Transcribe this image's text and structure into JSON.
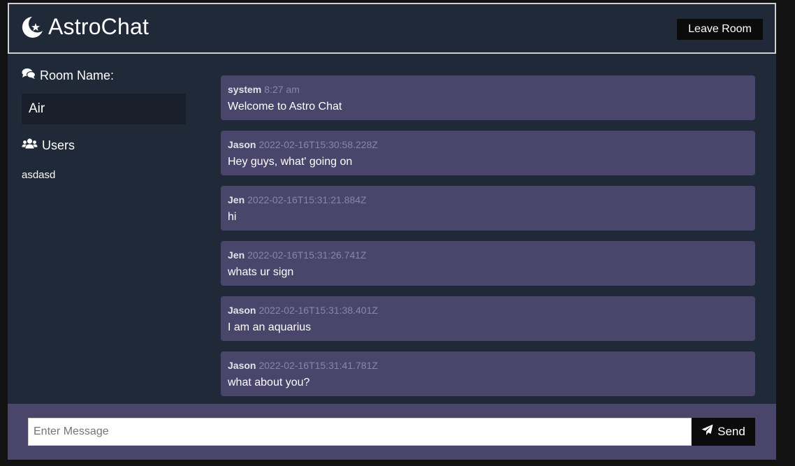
{
  "header": {
    "title": "AstroChat",
    "logo_icon": "moon-star-icon",
    "leave_label": "Leave Room"
  },
  "sidebar": {
    "room_heading": "Room Name:",
    "room_heading_icon": "comments-icon",
    "room_name": "Air",
    "users_heading": "Users",
    "users_heading_icon": "users-icon",
    "users": [
      "asdasd"
    ]
  },
  "messages": [
    {
      "author": "system",
      "time": "8:27 am",
      "text": "Welcome to Astro Chat"
    },
    {
      "author": "Jason",
      "time": "2022-02-16T15:30:58.228Z",
      "text": "Hey guys, what' going on"
    },
    {
      "author": "Jen",
      "time": "2022-02-16T15:31:21.884Z",
      "text": "hi"
    },
    {
      "author": "Jen",
      "time": "2022-02-16T15:31:26.741Z",
      "text": "whats ur sign"
    },
    {
      "author": "Jason",
      "time": "2022-02-16T15:31:38.401Z",
      "text": "I am an aquarius"
    },
    {
      "author": "Jason",
      "time": "2022-02-16T15:31:41.781Z",
      "text": "what about you?"
    }
  ],
  "composer": {
    "placeholder": "Enter Message",
    "value": "",
    "send_label": "Send",
    "send_icon": "paper-plane-icon"
  },
  "colors": {
    "background": "#1f2937",
    "message_bubble": "#49456b",
    "button": "#0b0b0b"
  }
}
